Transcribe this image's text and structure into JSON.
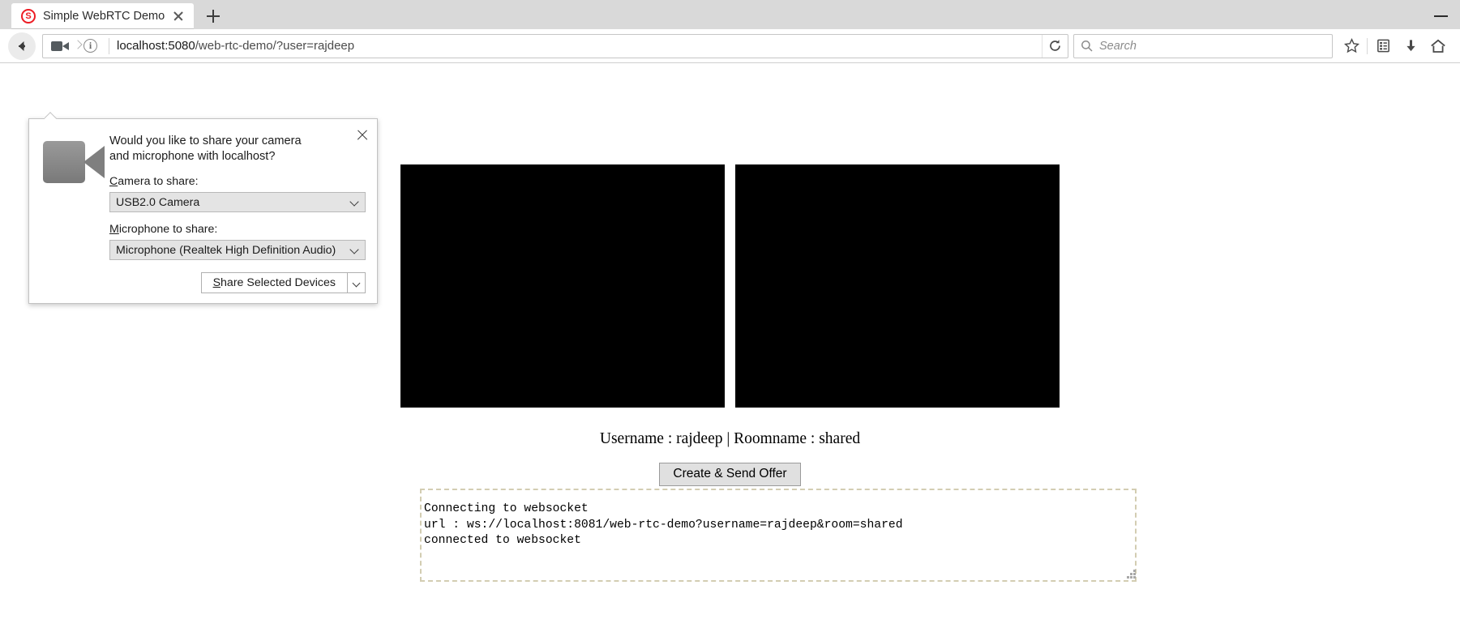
{
  "browser": {
    "tab": {
      "title": "Simple WebRTC Demo",
      "favicon_icon": "webrtc-logo-icon",
      "close_icon": "close-icon"
    },
    "new_tab_icon": "plus-icon",
    "window_controls": {
      "minimize_icon": "minimize-icon"
    },
    "nav": {
      "back_icon": "back-arrow-icon",
      "camera_permission_icon": "camera-icon",
      "permission_chevron_icon": "chevron-right-icon",
      "site_info_icon": "info-icon",
      "url_host": "localhost:5080",
      "url_path": "/web-rtc-demo/?user=rajdeep",
      "reload_icon": "reload-icon",
      "search_icon": "search-icon",
      "search_placeholder": "Search",
      "search_value": "",
      "bookmark_icon": "star-icon",
      "library_icon": "library-icon",
      "downloads_icon": "download-arrow-icon",
      "home_icon": "home-icon"
    }
  },
  "doorhanger": {
    "device_icon": "camera-icon",
    "close_icon": "close-icon",
    "question": "Would you like to share your camera and microphone with localhost?",
    "camera_label_accel": "C",
    "camera_label_rest": "amera to share:",
    "camera_value": "USB2.0 Camera",
    "camera_caret_icon": "chevron-down-icon",
    "microphone_label_accel": "M",
    "microphone_label_rest": "icrophone to share:",
    "microphone_value": "Microphone (Realtek High Definition Audio)",
    "microphone_caret_icon": "chevron-down-icon",
    "share_button_accel": "S",
    "share_button_rest": "hare Selected Devices",
    "share_split_caret_icon": "chevron-down-icon"
  },
  "page": {
    "local_video_label": "local-video",
    "remote_video_label": "remote-video",
    "identity_line": "Username : rajdeep | Roomname : shared",
    "offer_button": "Create & Send Offer",
    "log_text": "Connecting to websocket\nurl : ws://localhost:8081/web-rtc-demo?username=rajdeep&room=shared\nconnected to websocket",
    "log_resize_grip_icon": "resize-grip-icon"
  },
  "colors": {
    "tabstrip_bg": "#d9d9d9",
    "video_bg": "#000000",
    "log_border": "#d3cdb2",
    "button_bg": "#e0e0e0"
  }
}
